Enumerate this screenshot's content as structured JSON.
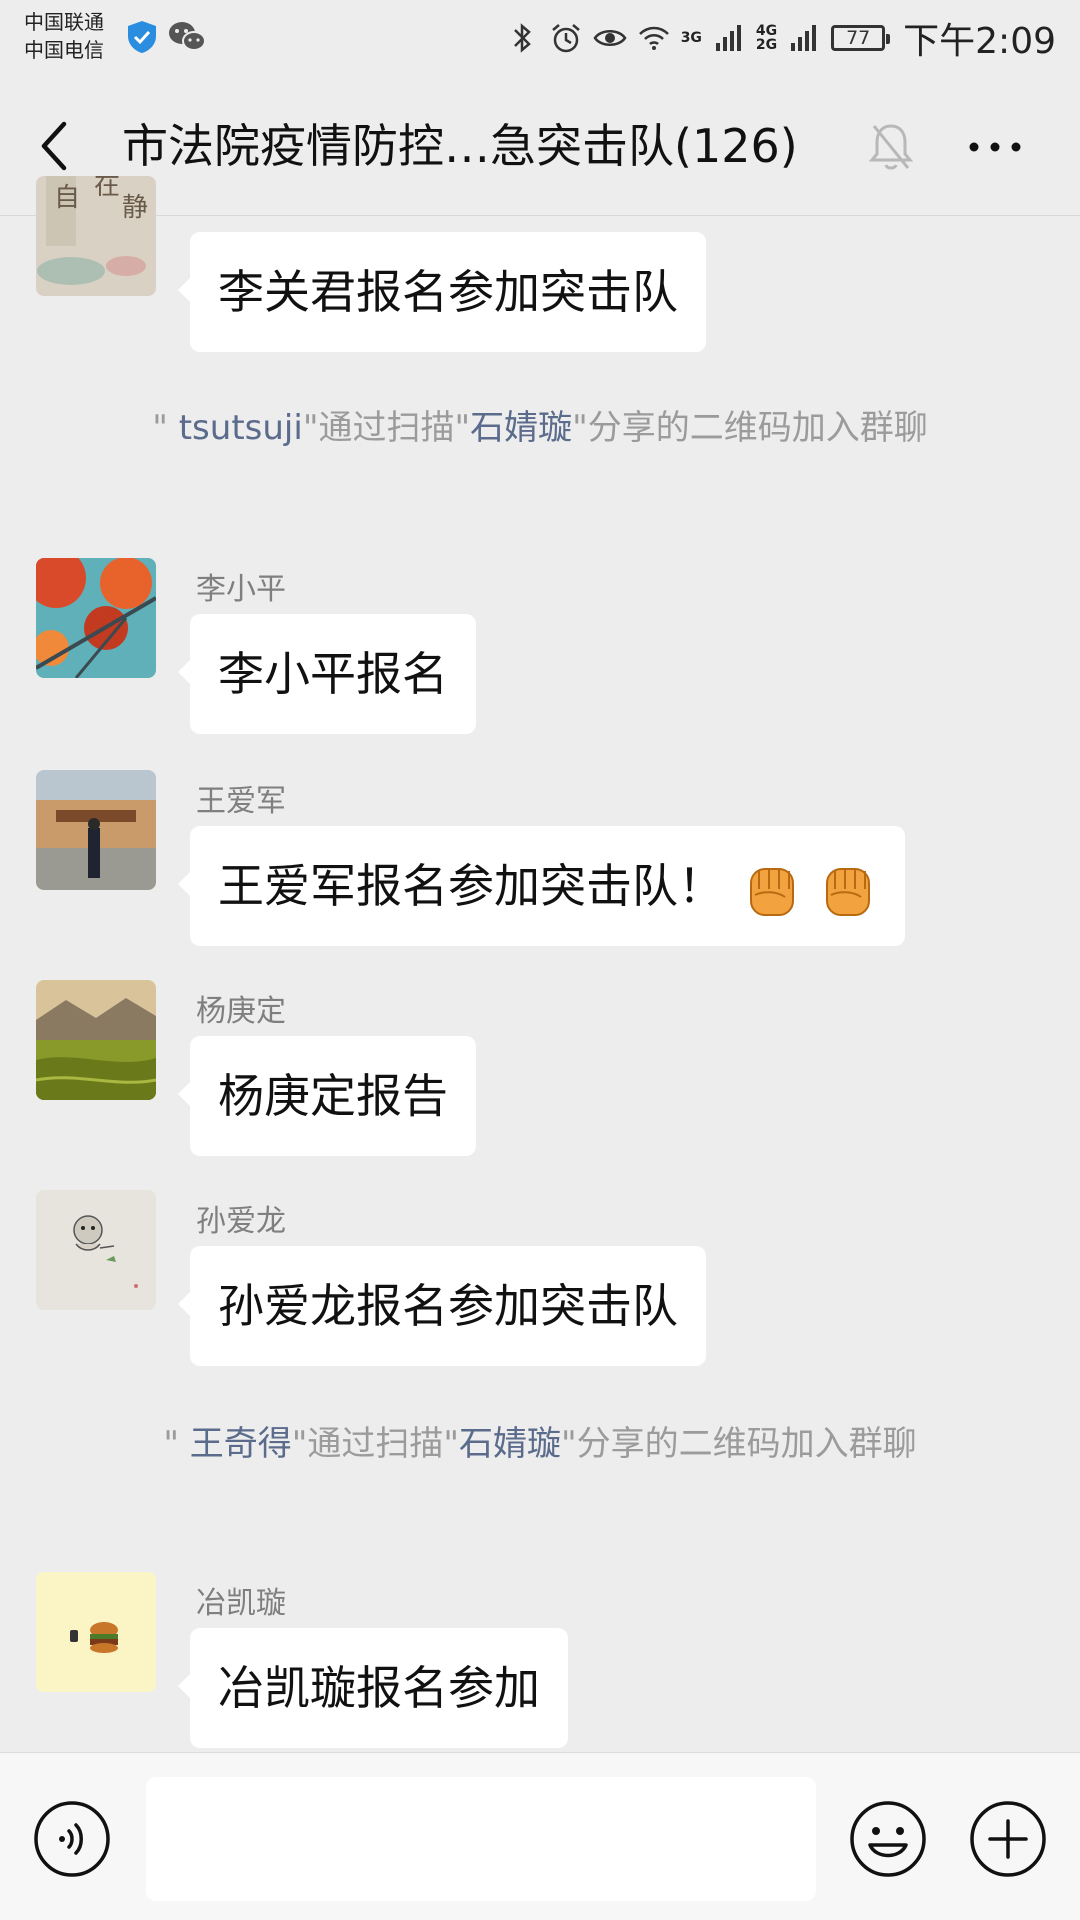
{
  "status_bar": {
    "carrier_1": "中国联通",
    "carrier_2": "中国电信",
    "net_top": "4G",
    "net_bottom": "2G",
    "net_small": "3G",
    "battery": "77",
    "time": "下午2:09"
  },
  "header": {
    "title": "市法院疫情防控…急突击队(126)"
  },
  "messages": {
    "m1": {
      "text": "李关君报名参加突击队"
    },
    "sys1": {
      "quote_open": "\" ",
      "name": "tsutsuji",
      "part1": "\"通过扫描\"",
      "name2": "石婧璇",
      "part2": "\"分享的二维码加入群聊"
    },
    "m2": {
      "sender": "李小平",
      "text": "李小平报名"
    },
    "m3": {
      "sender": "王爱军",
      "text": "王爱军报名参加突击队！"
    },
    "m4": {
      "sender": "杨庚定",
      "text": "杨庚定报告"
    },
    "m5": {
      "sender": "孙爱龙",
      "text": "孙爱龙报名参加突击队"
    },
    "sys2": {
      "quote_open": "\" ",
      "name": "王奇得",
      "part1": "\"通过扫描\"",
      "name2": "石婧璇",
      "part2": "\"分享的二维码加入群聊"
    },
    "m6": {
      "sender": "冶凯璇",
      "text": "冶凯璇报名参加"
    }
  },
  "icons": {
    "back": "chevron-left-icon",
    "mute": "bell-off-icon",
    "more": "more-dots-icon",
    "voice": "voice-icon",
    "emoji": "emoji-icon",
    "plus": "plus-icon",
    "fist": "fist-emoji-icon"
  },
  "colors": {
    "background": "#ededed",
    "bubble": "#ffffff",
    "system_text": "#9b9b9b",
    "system_name": "#5b6b8c",
    "sender_name": "#7f7f7f"
  }
}
